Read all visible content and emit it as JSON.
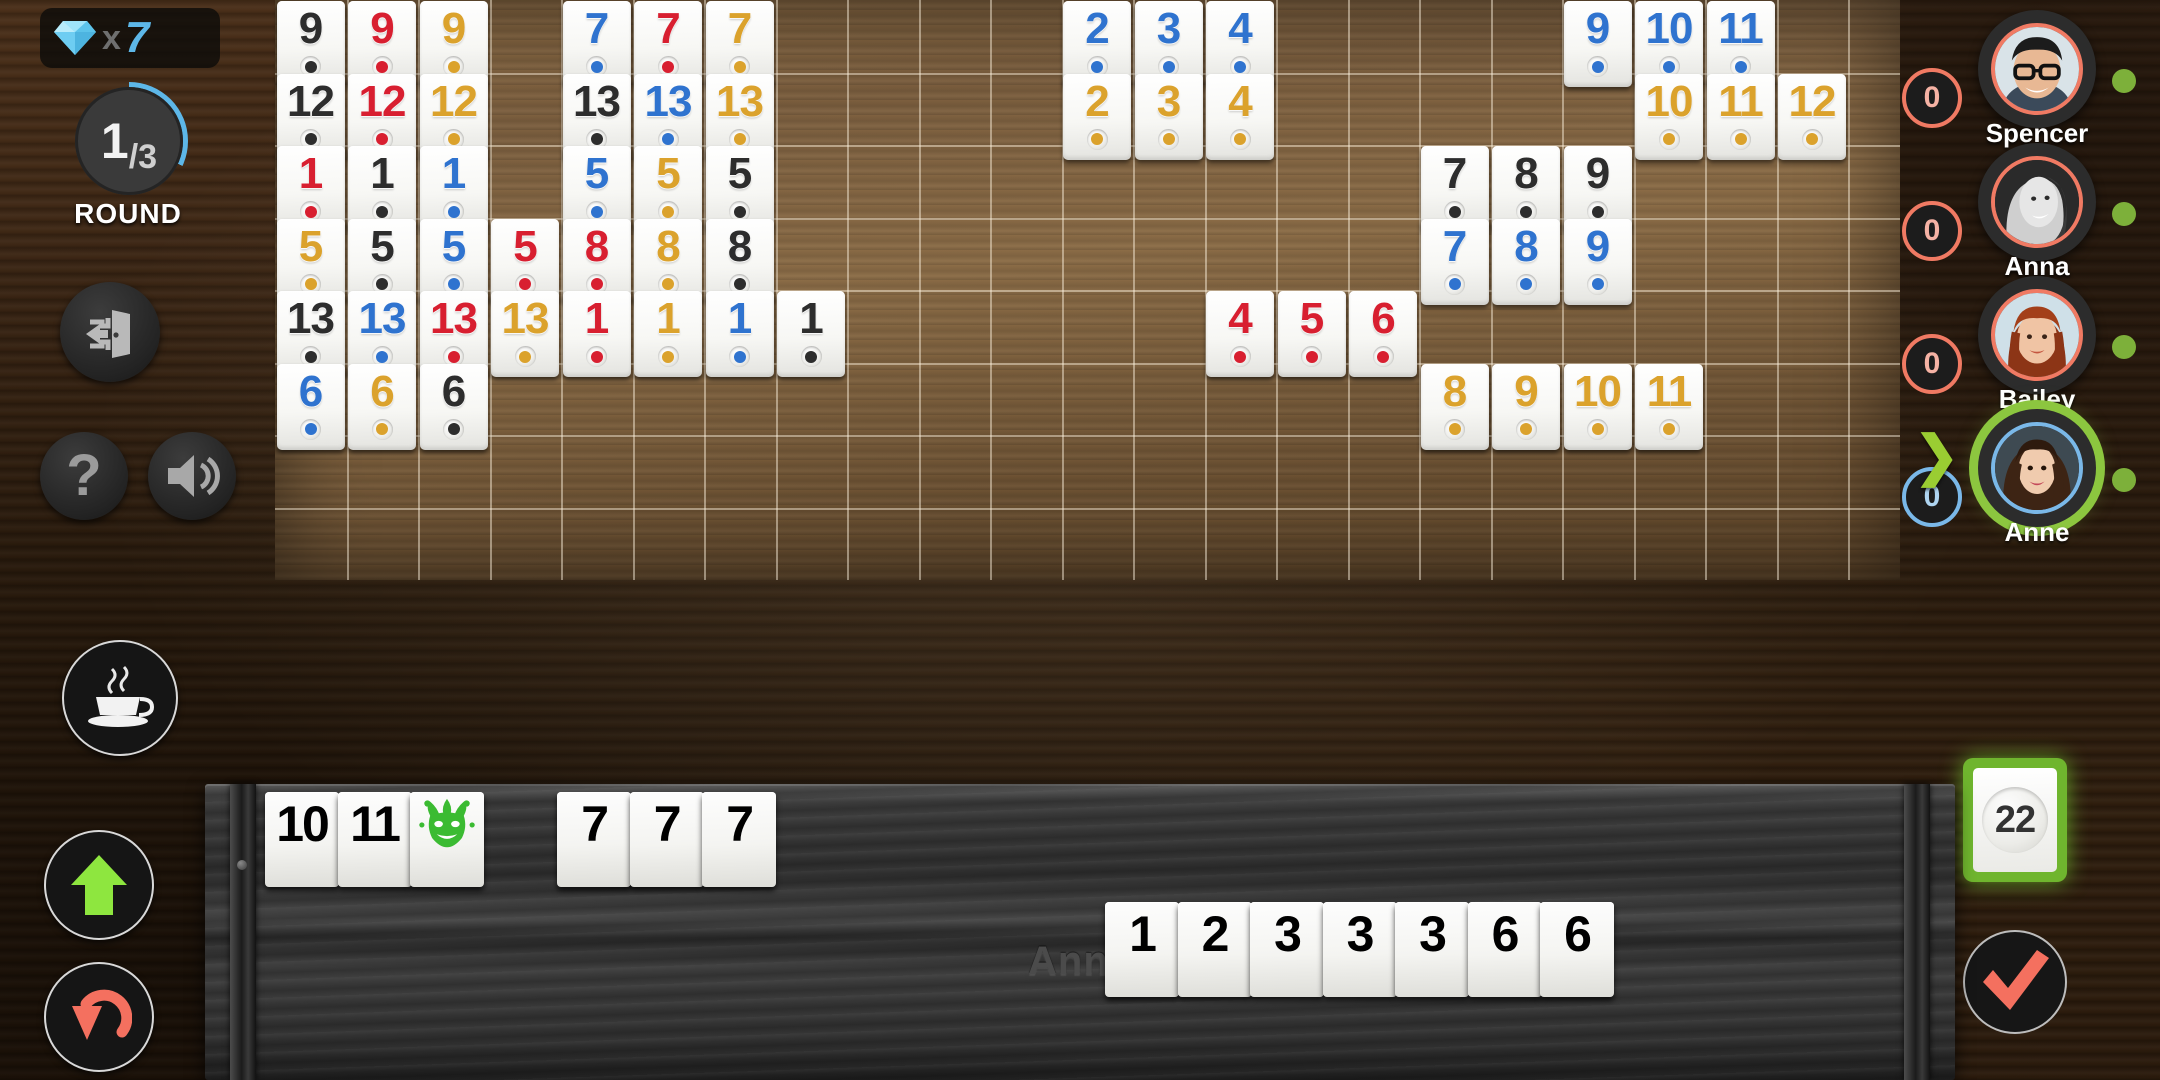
{
  "hud": {
    "gem_icon": "diamond-icon",
    "gem_multiplier": "x",
    "gem_count": "7",
    "round_current": "1",
    "round_total": "/3",
    "round_label": "ROUND",
    "exit_icon": "exit-door-icon",
    "help_icon": "question-mark-icon",
    "sound_icon": "speaker-icon",
    "break_icon": "coffee-cup-icon",
    "sort_icon": "up-arrow-icon",
    "undo_icon": "undo-arrow-icon",
    "accent_blue": "#5db7e8",
    "accent_green": "#8cc63f",
    "accent_red": "#f07a63"
  },
  "players": [
    {
      "name": "Spencer",
      "score": "0",
      "online": true,
      "active": false
    },
    {
      "name": "Anna",
      "score": "0",
      "online": true,
      "active": false
    },
    {
      "name": "Bailey",
      "score": "0",
      "online": true,
      "active": false
    },
    {
      "name": "Anne",
      "score": "0",
      "online": true,
      "active": true
    }
  ],
  "draw_pile": {
    "count": "22",
    "label": "tiles-remaining"
  },
  "confirm": {
    "icon": "checkmark-icon"
  },
  "rack": {
    "owner_name": "Anne",
    "top_row": [
      {
        "value": "10",
        "color": "black",
        "joker": false
      },
      {
        "value": "11",
        "color": "black",
        "joker": false
      },
      {
        "value": "",
        "color": "joker",
        "joker": true
      },
      {
        "value": "7",
        "color": "black",
        "joker": false
      },
      {
        "value": "7",
        "color": "red",
        "joker": false
      },
      {
        "value": "7",
        "color": "gold",
        "joker": false
      }
    ],
    "bottom_row": [
      {
        "value": "1",
        "color": "gold",
        "joker": false
      },
      {
        "value": "2",
        "color": "red",
        "joker": false
      },
      {
        "value": "3",
        "color": "black",
        "joker": false
      },
      {
        "value": "3",
        "color": "black",
        "joker": false
      },
      {
        "value": "3",
        "color": "red",
        "joker": false
      },
      {
        "value": "6",
        "color": "blue",
        "joker": false
      },
      {
        "value": "6",
        "color": "gold",
        "joker": false
      }
    ]
  },
  "board": {
    "melds": [
      {
        "name": "set-nines",
        "row": 0,
        "col": 0,
        "tiles": [
          {
            "v": "9",
            "c": "black"
          },
          {
            "v": "9",
            "c": "red"
          },
          {
            "v": "9",
            "c": "gold"
          }
        ]
      },
      {
        "name": "set-sevens",
        "row": 0,
        "col": 4,
        "tiles": [
          {
            "v": "7",
            "c": "blue"
          },
          {
            "v": "7",
            "c": "red"
          },
          {
            "v": "7",
            "c": "gold"
          }
        ]
      },
      {
        "name": "run-blue-2-3-4",
        "row": 0,
        "col": 11,
        "tiles": [
          {
            "v": "2",
            "c": "blue"
          },
          {
            "v": "3",
            "c": "blue"
          },
          {
            "v": "4",
            "c": "blue"
          }
        ]
      },
      {
        "name": "run-blue-9-10-11",
        "row": 0,
        "col": 18,
        "tiles": [
          {
            "v": "9",
            "c": "blue"
          },
          {
            "v": "10",
            "c": "blue"
          },
          {
            "v": "11",
            "c": "blue"
          }
        ]
      },
      {
        "name": "set-twelves",
        "row": 1,
        "col": 0,
        "tiles": [
          {
            "v": "12",
            "c": "black"
          },
          {
            "v": "12",
            "c": "red"
          },
          {
            "v": "12",
            "c": "gold"
          }
        ]
      },
      {
        "name": "set-thirteens-a",
        "row": 1,
        "col": 4,
        "tiles": [
          {
            "v": "13",
            "c": "black"
          },
          {
            "v": "13",
            "c": "blue"
          },
          {
            "v": "13",
            "c": "gold"
          }
        ]
      },
      {
        "name": "run-gold-2-3-4",
        "row": 1,
        "col": 11,
        "tiles": [
          {
            "v": "2",
            "c": "gold"
          },
          {
            "v": "3",
            "c": "gold"
          },
          {
            "v": "4",
            "c": "gold"
          }
        ]
      },
      {
        "name": "run-gold-10-11-12",
        "row": 1,
        "col": 19,
        "tiles": [
          {
            "v": "10",
            "c": "gold"
          },
          {
            "v": "11",
            "c": "gold"
          },
          {
            "v": "12",
            "c": "gold"
          }
        ]
      },
      {
        "name": "set-ones-a",
        "row": 2,
        "col": 0,
        "tiles": [
          {
            "v": "1",
            "c": "red"
          },
          {
            "v": "1",
            "c": "black"
          },
          {
            "v": "1",
            "c": "blue"
          }
        ]
      },
      {
        "name": "set-fives-a",
        "row": 2,
        "col": 4,
        "tiles": [
          {
            "v": "5",
            "c": "blue"
          },
          {
            "v": "5",
            "c": "gold"
          },
          {
            "v": "5",
            "c": "black"
          }
        ]
      },
      {
        "name": "run-black-7-8-9",
        "row": 2,
        "col": 16,
        "tiles": [
          {
            "v": "7",
            "c": "black"
          },
          {
            "v": "8",
            "c": "black"
          },
          {
            "v": "9",
            "c": "black"
          }
        ]
      },
      {
        "name": "set-fives-b",
        "row": 3,
        "col": 0,
        "tiles": [
          {
            "v": "5",
            "c": "gold"
          },
          {
            "v": "5",
            "c": "black"
          },
          {
            "v": "5",
            "c": "blue"
          },
          {
            "v": "5",
            "c": "red"
          }
        ]
      },
      {
        "name": "set-eights",
        "row": 3,
        "col": 4,
        "tiles": [
          {
            "v": "8",
            "c": "red"
          },
          {
            "v": "8",
            "c": "gold"
          },
          {
            "v": "8",
            "c": "black"
          }
        ]
      },
      {
        "name": "run-blue-7-8-9",
        "row": 3,
        "col": 16,
        "tiles": [
          {
            "v": "7",
            "c": "blue"
          },
          {
            "v": "8",
            "c": "blue"
          },
          {
            "v": "9",
            "c": "blue"
          }
        ]
      },
      {
        "name": "set-thirteens-b",
        "row": 4,
        "col": 0,
        "tiles": [
          {
            "v": "13",
            "c": "black"
          },
          {
            "v": "13",
            "c": "blue"
          },
          {
            "v": "13",
            "c": "red"
          },
          {
            "v": "13",
            "c": "gold"
          }
        ]
      },
      {
        "name": "set-ones-b",
        "row": 4,
        "col": 4,
        "tiles": [
          {
            "v": "1",
            "c": "red"
          },
          {
            "v": "1",
            "c": "gold"
          },
          {
            "v": "1",
            "c": "blue"
          },
          {
            "v": "1",
            "c": "black"
          }
        ]
      },
      {
        "name": "run-red-4-5-6",
        "row": 4,
        "col": 13,
        "tiles": [
          {
            "v": "4",
            "c": "red"
          },
          {
            "v": "5",
            "c": "red"
          },
          {
            "v": "6",
            "c": "red"
          }
        ]
      },
      {
        "name": "set-sixes",
        "row": 5,
        "col": 0,
        "tiles": [
          {
            "v": "6",
            "c": "blue"
          },
          {
            "v": "6",
            "c": "gold"
          },
          {
            "v": "6",
            "c": "black"
          }
        ]
      },
      {
        "name": "run-gold-8-9-10-11",
        "row": 5,
        "col": 16,
        "tiles": [
          {
            "v": "8",
            "c": "gold"
          },
          {
            "v": "9",
            "c": "gold"
          },
          {
            "v": "10",
            "c": "gold"
          },
          {
            "v": "11",
            "c": "gold"
          }
        ]
      }
    ],
    "colors": {
      "black": "#2d2d2d",
      "red": "#d81f30",
      "blue": "#2f73cf",
      "gold": "#dba22c"
    }
  }
}
